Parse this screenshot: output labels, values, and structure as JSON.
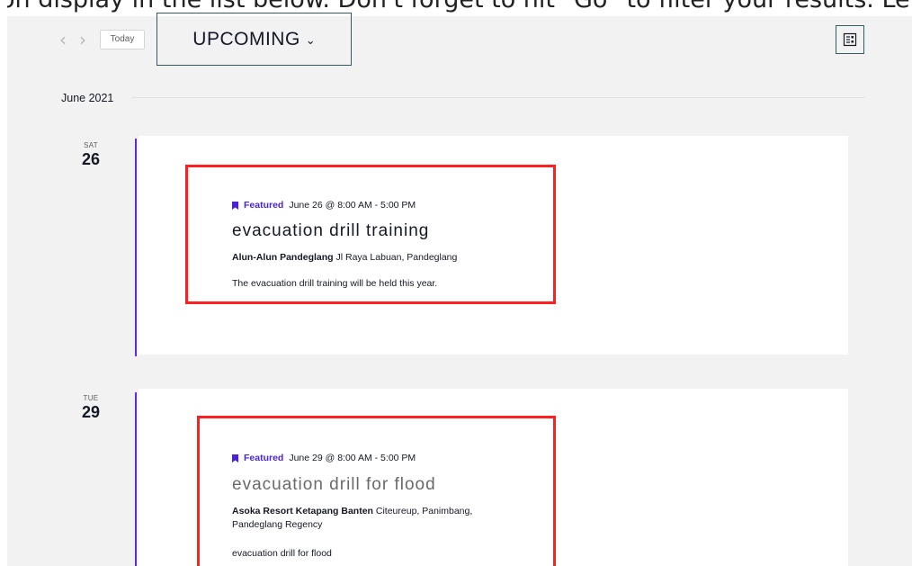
{
  "top_strip_text": "on display in the list below. Don't forget to hit \"Go\" to filter your results. Let's start by adding a category to your",
  "toolbar": {
    "prev_icon": "chevron-left-icon",
    "next_icon": "chevron-right-icon",
    "today_label": "Today",
    "view_selector_label": "UPCOMING",
    "view_icon": "list-view-icon"
  },
  "month_label": "June 2021",
  "events": [
    {
      "dow": "SAT",
      "dom": "26",
      "featured": "Featured",
      "datetime": "June 26 @ 8:00 AM - 5:00 PM",
      "title": "evacuation drill training",
      "venue_name": "Alun-Alun Pandeglang",
      "venue_address": "Jl Raya Labuan, Pandeglang",
      "venue_address_2": "",
      "description": "The evacuation drill training will be held this year."
    },
    {
      "dow": "TUE",
      "dom": "29",
      "featured": "Featured",
      "datetime": "June 29 @ 8:00 AM - 5:00 PM",
      "title": "evacuation drill for flood",
      "venue_name": "Asoka Resort Ketapang Banten",
      "venue_address": "Citeureup, Panimbang,",
      "venue_address_2": "Pandeglang Regency",
      "description": "evacuation drill for flood"
    }
  ],
  "colors": {
    "accent": "#4b23d6",
    "highlight_box": "#ff1f1f",
    "button_border": "#2f5d62",
    "background": "#f2f2f2"
  }
}
